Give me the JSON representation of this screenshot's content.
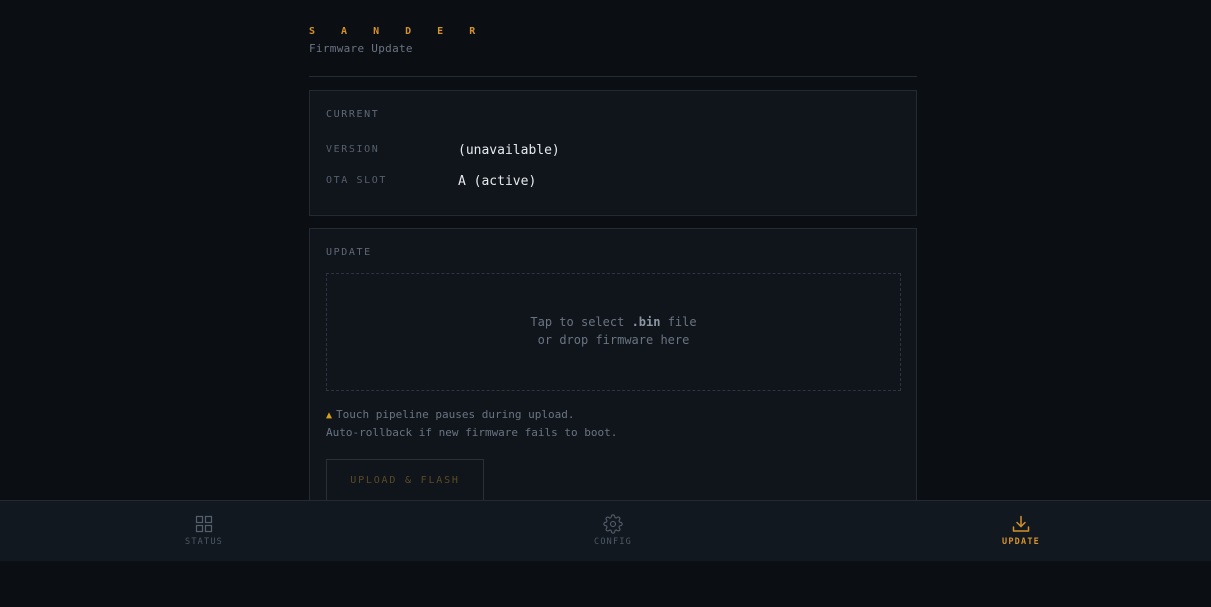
{
  "header": {
    "brand": "S A N D E R",
    "subtitle": "Firmware Update"
  },
  "current": {
    "title": "CURRENT",
    "rows": [
      {
        "label": "VERSION",
        "value": "(unavailable)"
      },
      {
        "label": "OTA SLOT",
        "value": "A (active)"
      }
    ]
  },
  "update": {
    "title": "UPDATE",
    "dropzone": {
      "line1_prefix": "Tap to select ",
      "line1_ext": ".bin",
      "line1_suffix": " file",
      "line2": "or drop firmware here"
    },
    "note_1": "Touch pipeline pauses during upload.",
    "note_2": "Auto-rollback if new firmware fails to boot.",
    "upload_button": "UPLOAD & FLASH"
  },
  "tabs": [
    {
      "label": "STATUS",
      "icon": "grid-icon"
    },
    {
      "label": "CONFIG",
      "icon": "gear-icon"
    },
    {
      "label": "UPDATE",
      "icon": "download-icon",
      "active": true
    }
  ],
  "colors": {
    "accent": "#d4922a",
    "background": "#0b0e13",
    "card": "#10151c",
    "warning": "#d4a017"
  }
}
